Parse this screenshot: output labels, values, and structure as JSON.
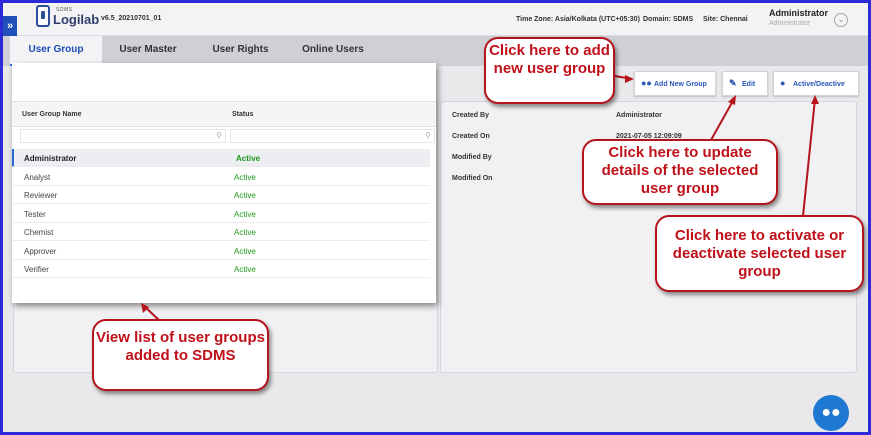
{
  "header": {
    "logo_small": "SDMS",
    "logo_text": "Logilab",
    "version": "v6.5_20210701_01",
    "timezone": "Time Zone: Asia/Kolkata (UTC+05:30)",
    "domain": "Domain: SDMS",
    "site": "Site: Chennai",
    "user_name": "Administrator",
    "user_role": "Administrator"
  },
  "tabs": [
    "User Group",
    "User Master",
    "User Rights",
    "Online Users"
  ],
  "toolbar": {
    "add_label": "Add New Group",
    "edit_label": "Edit",
    "toggle_label": "Active/Deactive"
  },
  "grid": {
    "col_name": "User Group Name",
    "col_status": "Status",
    "rows": [
      {
        "name": "Administrator",
        "status": "Active"
      },
      {
        "name": "Analyst",
        "status": "Active"
      },
      {
        "name": "Reviewer",
        "status": "Active"
      },
      {
        "name": "Tester",
        "status": "Active"
      },
      {
        "name": "Chemist",
        "status": "Active"
      },
      {
        "name": "Approver",
        "status": "Active"
      },
      {
        "name": "Verifier",
        "status": "Active"
      }
    ]
  },
  "details": {
    "created_by_label": "Created By",
    "created_by_value": "Administrator",
    "created_on_label": "Created On",
    "created_on_value": "2021-07-05 12:09:09",
    "modified_by_label": "Modified By",
    "modified_on_label": "Modified On"
  },
  "callouts": {
    "add": "Click here to add new user group",
    "edit": "Click here to update details of the selected user group",
    "toggle": "Click here to activate or deactivate selected user group",
    "list": "View list of user groups added to SDMS"
  },
  "colors": {
    "accent": "#2d6ad8",
    "active_status": "#1f9a1f",
    "callout": "#c0111a"
  }
}
